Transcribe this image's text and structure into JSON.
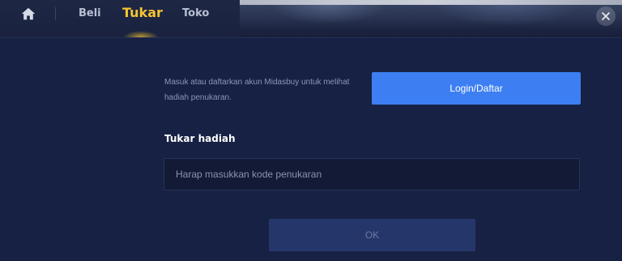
{
  "nav": {
    "home_icon": "home-icon",
    "tabs": [
      {
        "label": "Beli",
        "active": false
      },
      {
        "label": "Tukar",
        "active": true
      },
      {
        "label": "Toko",
        "active": false
      }
    ],
    "close_icon": "close-icon"
  },
  "login": {
    "message": "Masuk atau daftarkan akun Midasbuy untuk melihat hadiah penukaran.",
    "button_label": "Login/Daftar"
  },
  "redeem": {
    "title": "Tukar hadiah",
    "code_placeholder": "Harap masukkan kode penukaran",
    "code_value": "",
    "ok_label": "OK"
  },
  "colors": {
    "background": "#172144",
    "active_tab": "#f4c430",
    "primary_button": "#3d7ff2",
    "disabled_button": "#25376a"
  }
}
